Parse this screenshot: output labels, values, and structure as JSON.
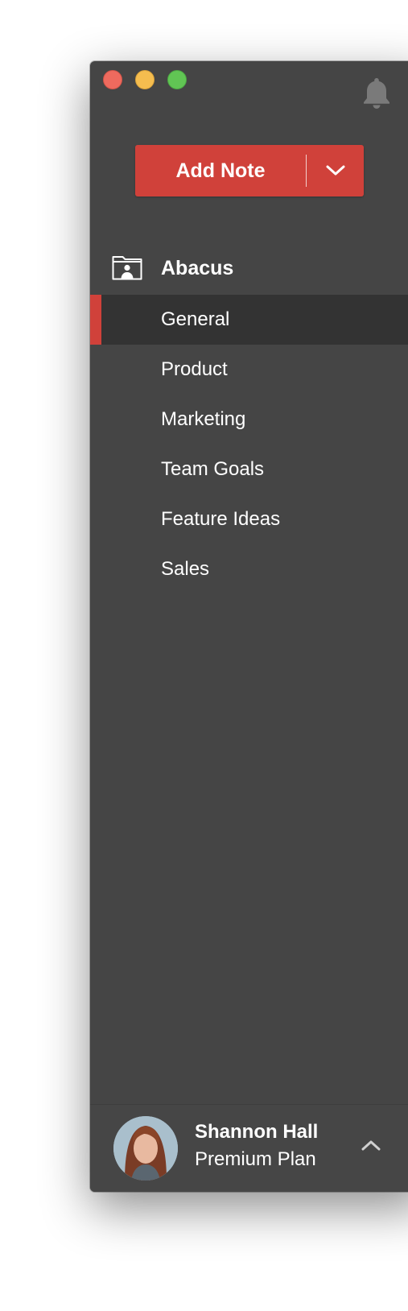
{
  "window": {
    "controls": [
      "close",
      "minimize",
      "maximize"
    ]
  },
  "header": {
    "notifications_icon": "bell-icon"
  },
  "add_note": {
    "label": "Add Note",
    "dropdown_icon": "chevron-down-icon"
  },
  "project": {
    "icon": "shared-folder-icon",
    "name": "Abacus"
  },
  "notebooks": [
    {
      "label": "General",
      "active": true
    },
    {
      "label": "Product",
      "active": false
    },
    {
      "label": "Marketing",
      "active": false
    },
    {
      "label": "Team Goals",
      "active": false
    },
    {
      "label": "Feature Ideas",
      "active": false
    },
    {
      "label": "Sales",
      "active": false
    }
  ],
  "user": {
    "name": "Shannon Hall",
    "plan": "Premium Plan",
    "menu_icon": "chevron-up-icon"
  },
  "colors": {
    "accent": "#d0413a",
    "sidebar": "#454545",
    "active_row": "#333333"
  }
}
